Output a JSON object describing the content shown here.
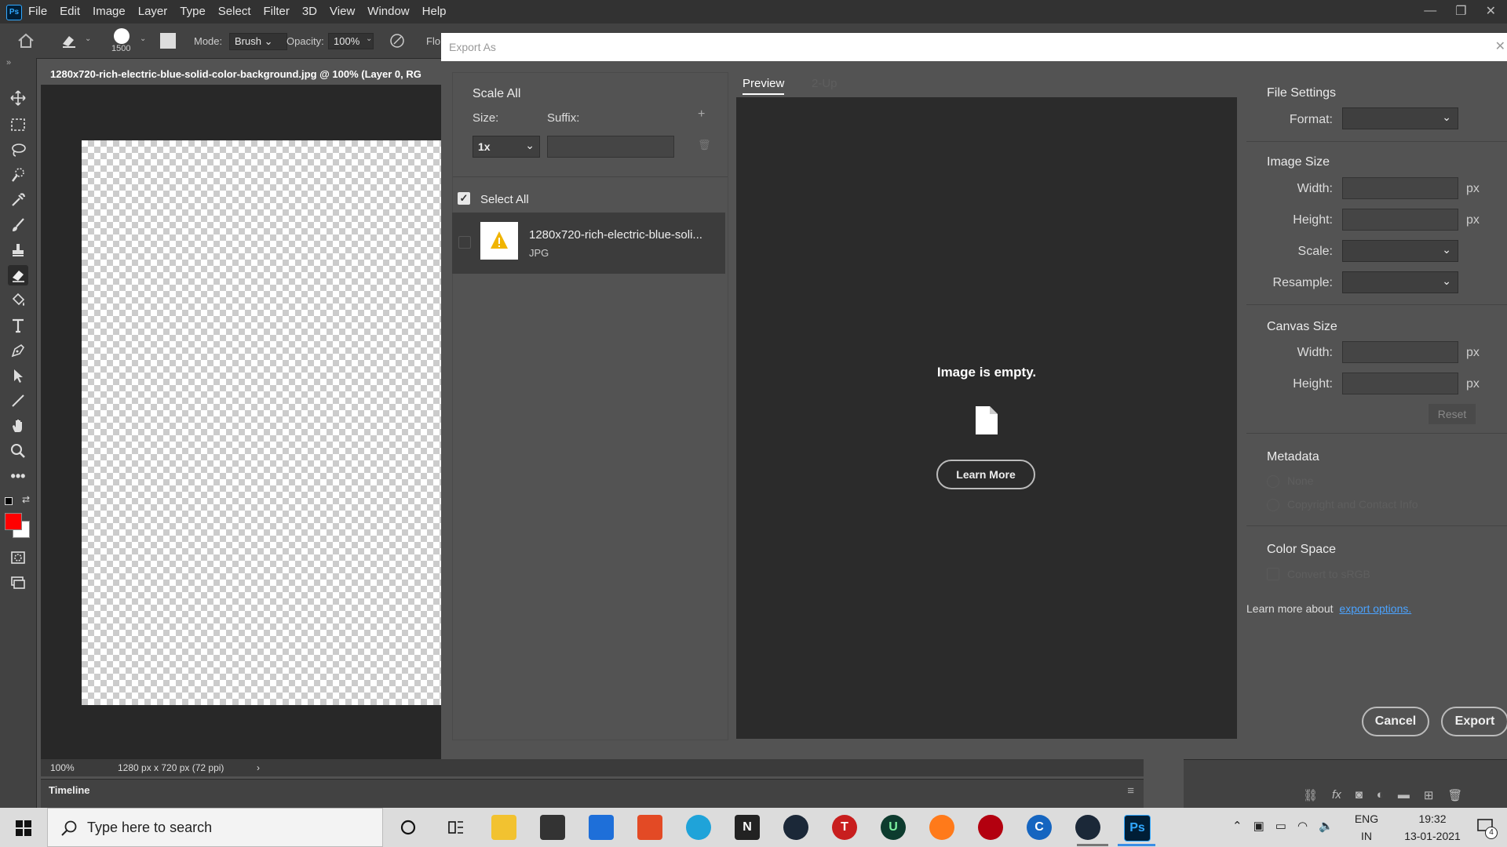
{
  "menubar": {
    "logo": "Ps",
    "items": [
      "File",
      "Edit",
      "Image",
      "Layer",
      "Type",
      "Select",
      "Filter",
      "3D",
      "View",
      "Window",
      "Help"
    ]
  },
  "options_bar": {
    "brush_size": "1500",
    "mode_label": "Mode:",
    "mode_value": "Brush",
    "opacity_label": "Opacity:",
    "opacity_value": "100%",
    "flow_label": "Flo"
  },
  "document": {
    "tab_title": "1280x720-rich-electric-blue-solid-color-background.jpg @ 100% (Layer 0, RG",
    "zoom": "100%",
    "doc_info": "1280 px x 720 px (72 ppi)",
    "timeline_label": "Timeline"
  },
  "dialog": {
    "title": "Export As",
    "scale_all": "Scale All",
    "size_label": "Size:",
    "suffix_label": "Suffix:",
    "size_value": "1x",
    "suffix_value": "",
    "select_all": "Select All",
    "file_name": "1280x720-rich-electric-blue-soli...",
    "file_type": "JPG",
    "preview_tab": "Preview",
    "twoup_tab": "2-Up",
    "empty_message": "Image is empty.",
    "learn_more": "Learn More",
    "file_settings": "File Settings",
    "format_label": "Format:",
    "image_size": "Image Size",
    "width_label": "Width:",
    "height_label": "Height:",
    "scale_label": "Scale:",
    "resample_label": "Resample:",
    "px": "px",
    "canvas_size": "Canvas Size",
    "reset": "Reset",
    "metadata": "Metadata",
    "meta_none": "None",
    "meta_copyright": "Copyright and Contact Info",
    "color_space": "Color Space",
    "convert_srgb": "Convert to sRGB",
    "learn_more_about": "Learn more about",
    "export_options": "export options.",
    "cancel": "Cancel",
    "export": "Export"
  },
  "taskbar": {
    "search_placeholder": "Type here to search",
    "lang_top": "ENG",
    "lang_bottom": "IN",
    "time": "19:32",
    "date": "13-01-2021",
    "notification_count": "4"
  },
  "colors": {
    "foreground": "#ff0000",
    "background": "#ffffff",
    "link": "#4ba3ff"
  }
}
